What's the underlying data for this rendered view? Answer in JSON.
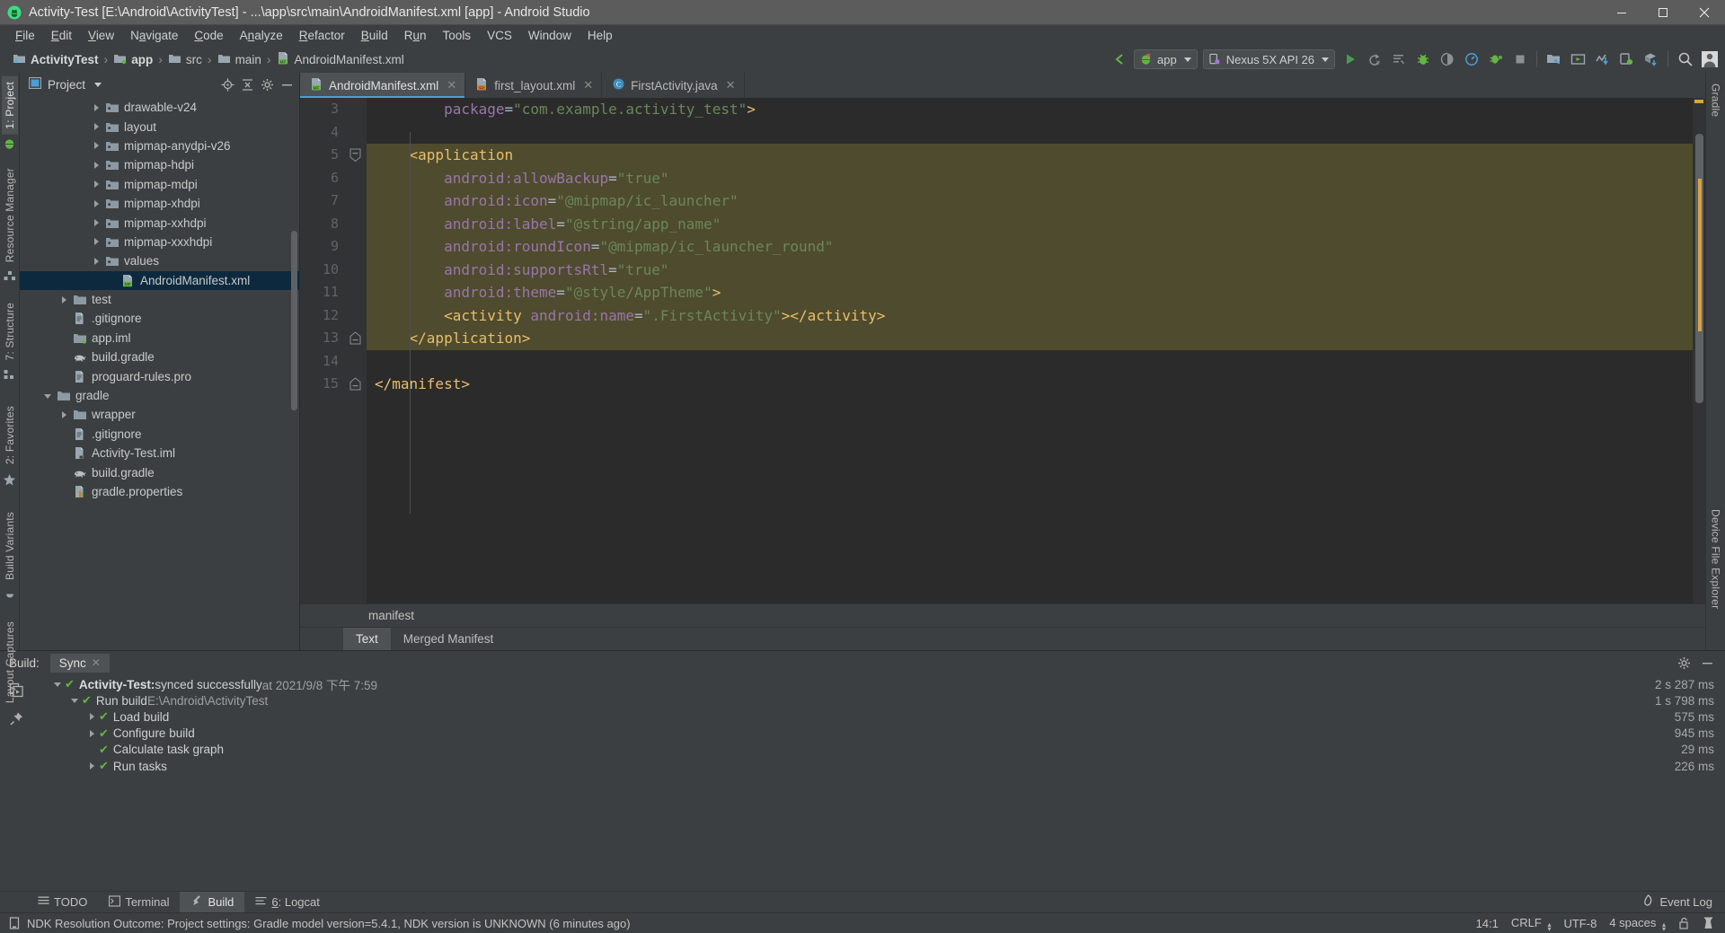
{
  "window": {
    "title": "Activity-Test [E:\\Android\\ActivityTest] - ...\\app\\src\\main\\AndroidManifest.xml [app] - Android Studio",
    "minimize": "–",
    "maximize": "▢",
    "close": "✕"
  },
  "menu": {
    "items": [
      "File",
      "Edit",
      "View",
      "Navigate",
      "Code",
      "Analyze",
      "Refactor",
      "Build",
      "Run",
      "Tools",
      "VCS",
      "Window",
      "Help"
    ]
  },
  "navbar": {
    "breadcrumbs": [
      {
        "label": "ActivityTest",
        "icon": "module-icon",
        "bold": true
      },
      {
        "label": "app",
        "icon": "module-icon",
        "bold": true
      },
      {
        "label": "src",
        "icon": "folder-icon",
        "bold": false
      },
      {
        "label": "main",
        "icon": "folder-icon",
        "bold": false
      },
      {
        "label": "AndroidManifest.xml",
        "icon": "manifest-file-icon",
        "bold": false
      }
    ],
    "separator": "›",
    "module_selector": "app",
    "device_selector": "Nexus 5X API 26",
    "icons": [
      "back-arrow-icon",
      "run-icon",
      "rerun-icon",
      "apply-changes-icon",
      "debug-icon",
      "debug-attach-icon",
      "profiler-icon",
      "instant-run-icon",
      "stop-icon",
      "sdk-manager-icon",
      "avd-manager-icon",
      "sync-gradle-icon",
      "device-monitor-icon",
      "layout-inspector-icon",
      "search-icon",
      "avatar-icon"
    ]
  },
  "left_strip": {
    "tabs": [
      {
        "label": "1: Project",
        "active": true
      },
      {
        "label": "Resource Manager",
        "active": false
      },
      {
        "label": "7: Structure",
        "active": false
      },
      {
        "label": "2: Favorites",
        "active": false
      },
      {
        "label": "Build Variants",
        "active": false
      },
      {
        "label": "Layout Captures",
        "active": false
      }
    ]
  },
  "right_strip": {
    "tabs": [
      {
        "label": "Gradle"
      },
      {
        "label": "Device File Explorer"
      }
    ]
  },
  "project_panel": {
    "title": "Project",
    "dropdown_caret": "▾",
    "actions": [
      "locate-icon",
      "collapse-all-icon",
      "settings-icon",
      "hide-icon"
    ],
    "tree": [
      {
        "label": "drawable-v24",
        "indent": 4,
        "arrow": "closed",
        "icon": "res-folder-icon",
        "selected": false
      },
      {
        "label": "layout",
        "indent": 4,
        "arrow": "closed",
        "icon": "res-folder-icon",
        "selected": false
      },
      {
        "label": "mipmap-anydpi-v26",
        "indent": 4,
        "arrow": "closed",
        "icon": "res-folder-icon",
        "selected": false
      },
      {
        "label": "mipmap-hdpi",
        "indent": 4,
        "arrow": "closed",
        "icon": "res-folder-icon",
        "selected": false
      },
      {
        "label": "mipmap-mdpi",
        "indent": 4,
        "arrow": "closed",
        "icon": "res-folder-icon",
        "selected": false
      },
      {
        "label": "mipmap-xhdpi",
        "indent": 4,
        "arrow": "closed",
        "icon": "res-folder-icon",
        "selected": false
      },
      {
        "label": "mipmap-xxhdpi",
        "indent": 4,
        "arrow": "closed",
        "icon": "res-folder-icon",
        "selected": false
      },
      {
        "label": "mipmap-xxxhdpi",
        "indent": 4,
        "arrow": "closed",
        "icon": "res-folder-icon",
        "selected": false
      },
      {
        "label": "values",
        "indent": 4,
        "arrow": "closed",
        "icon": "res-folder-icon",
        "selected": false
      },
      {
        "label": "AndroidManifest.xml",
        "indent": 5,
        "arrow": "none",
        "icon": "manifest-file-icon",
        "selected": true
      },
      {
        "label": "test",
        "indent": 2,
        "arrow": "closed",
        "icon": "folder-icon",
        "selected": false
      },
      {
        "label": ".gitignore",
        "indent": 2,
        "arrow": "none",
        "icon": "text-file-icon",
        "selected": false
      },
      {
        "label": "app.iml",
        "indent": 2,
        "arrow": "none",
        "icon": "module-icon",
        "selected": false
      },
      {
        "label": "build.gradle",
        "indent": 2,
        "arrow": "none",
        "icon": "gradle-icon",
        "selected": false
      },
      {
        "label": "proguard-rules.pro",
        "indent": 2,
        "arrow": "none",
        "icon": "text-file-icon",
        "selected": false
      },
      {
        "label": "gradle",
        "indent": 1,
        "arrow": "open",
        "icon": "folder-icon",
        "selected": false
      },
      {
        "label": "wrapper",
        "indent": 2,
        "arrow": "closed",
        "icon": "folder-icon",
        "selected": false
      },
      {
        "label": ".gitignore",
        "indent": 2,
        "arrow": "none",
        "icon": "text-file-icon",
        "selected": false
      },
      {
        "label": "Activity-Test.iml",
        "indent": 2,
        "arrow": "none",
        "icon": "iml-file-icon",
        "selected": false
      },
      {
        "label": "build.gradle",
        "indent": 2,
        "arrow": "none",
        "icon": "gradle-icon",
        "selected": false
      },
      {
        "label": "gradle.properties",
        "indent": 2,
        "arrow": "none",
        "icon": "properties-icon",
        "selected": false
      }
    ]
  },
  "editor": {
    "tabs": [
      {
        "label": "AndroidManifest.xml",
        "icon": "manifest-file-icon",
        "active": true,
        "close": "✕"
      },
      {
        "label": "first_layout.xml",
        "icon": "layout-file-icon",
        "active": false,
        "close": "✕"
      },
      {
        "label": "FirstActivity.java",
        "icon": "java-class-icon",
        "active": false,
        "close": "✕"
      }
    ],
    "first_line_number": 3,
    "lines": [
      {
        "n": 3,
        "text": "        package=\"com.example.activity_test\">",
        "highlight": false,
        "fold": "none"
      },
      {
        "n": 4,
        "text": "",
        "highlight": false,
        "fold": "none"
      },
      {
        "n": 5,
        "text": "    <application",
        "highlight": true,
        "fold": "minus"
      },
      {
        "n": 6,
        "text": "        android:allowBackup=\"true\"",
        "highlight": true,
        "fold": "none"
      },
      {
        "n": 7,
        "text": "        android:icon=\"@mipmap/ic_launcher\"",
        "highlight": true,
        "fold": "none"
      },
      {
        "n": 8,
        "text": "        android:label=\"@string/app_name\"",
        "highlight": true,
        "fold": "none"
      },
      {
        "n": 9,
        "text": "        android:roundIcon=\"@mipmap/ic_launcher_round\"",
        "highlight": true,
        "fold": "none"
      },
      {
        "n": 10,
        "text": "        android:supportsRtl=\"true\"",
        "highlight": true,
        "fold": "none"
      },
      {
        "n": 11,
        "text": "        android:theme=\"@style/AppTheme\">",
        "highlight": true,
        "fold": "none"
      },
      {
        "n": 12,
        "text": "        <activity android:name=\".FirstActivity\"></activity>",
        "highlight": true,
        "fold": "none"
      },
      {
        "n": 13,
        "text": "    </application>",
        "highlight": true,
        "fold": "minus-end",
        "bulb": true
      },
      {
        "n": 14,
        "text": "",
        "highlight": false,
        "fold": "none"
      },
      {
        "n": 15,
        "text": "</manifest>",
        "highlight": false,
        "fold": "minus-end"
      }
    ],
    "breadcrumb": "manifest",
    "design_tabs": [
      {
        "label": "Text",
        "active": true
      },
      {
        "label": "Merged Manifest",
        "active": false
      }
    ]
  },
  "build_window": {
    "label": "Build:",
    "tab": "Sync",
    "tab_close": "✕",
    "actions": [
      "settings-icon",
      "hide-icon"
    ],
    "side_icons": [
      "restart-icon",
      "pin-icon"
    ],
    "rows": [
      {
        "indent": 0,
        "arrow": "open",
        "check": true,
        "bold": "Activity-Test:",
        "text": " synced successfully",
        "dim": " at 2021/9/8 下午 7:59",
        "time": "2 s 287 ms"
      },
      {
        "indent": 1,
        "arrow": "open",
        "check": true,
        "bold": "",
        "text": "Run build",
        "dim": " E:\\Android\\ActivityTest",
        "time": "1 s 798 ms"
      },
      {
        "indent": 2,
        "arrow": "closed",
        "check": true,
        "bold": "",
        "text": "Load build",
        "dim": "",
        "time": "575 ms"
      },
      {
        "indent": 2,
        "arrow": "closed",
        "check": true,
        "bold": "",
        "text": "Configure build",
        "dim": "",
        "time": "945 ms"
      },
      {
        "indent": 2,
        "arrow": "none",
        "check": true,
        "bold": "",
        "text": "Calculate task graph",
        "dim": "",
        "time": "29 ms"
      },
      {
        "indent": 2,
        "arrow": "closed",
        "check": true,
        "bold": "",
        "text": "Run tasks",
        "dim": "",
        "time": "226 ms"
      }
    ]
  },
  "bottom_tabs": {
    "items": [
      {
        "label": "TODO",
        "icon": "todo-icon",
        "active": false,
        "mnemonic": ""
      },
      {
        "label": "Terminal",
        "icon": "terminal-icon",
        "active": false,
        "mnemonic": ""
      },
      {
        "label": "Build",
        "icon": "build-icon",
        "active": true,
        "mnemonic": ""
      },
      {
        "label": "6: Logcat",
        "icon": "logcat-icon",
        "active": false,
        "mnemonic": "6"
      }
    ],
    "event_log": "Event Log",
    "event_log_icon": "event-log-icon"
  },
  "status_bar": {
    "message": "NDK Resolution Outcome: Project settings: Gradle model version=5.4.1, NDK version is UNKNOWN (6 minutes ago)",
    "message_icon": "info-icon",
    "caret": "14:1",
    "line_sep": "CRLF",
    "encoding": "UTF-8",
    "indent": "4 spaces",
    "lock_icon": "unlocked-icon",
    "inspection_icon": "inspector-icon"
  },
  "colors": {
    "accent": "#4a9fd8",
    "success": "#62b543",
    "highlight_block": "#4f4b2e",
    "selection": "#0d293e",
    "editor_bg": "#2b2b2b",
    "panel_bg": "#3c3f41"
  }
}
